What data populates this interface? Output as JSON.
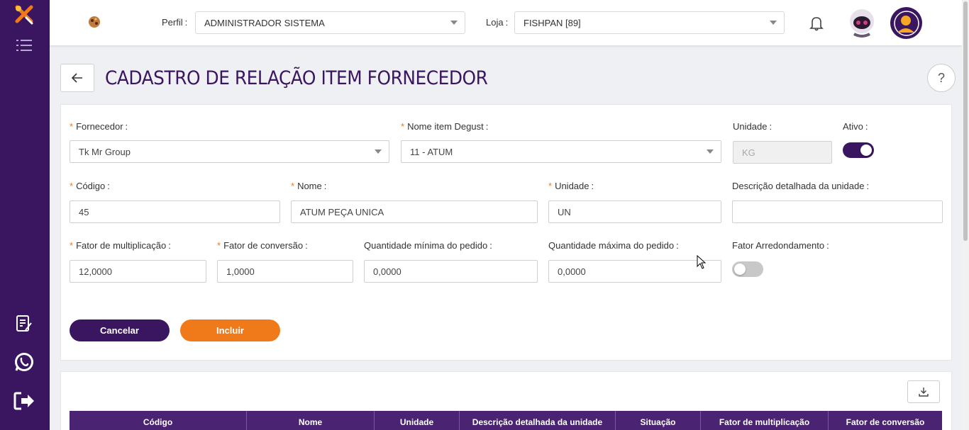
{
  "header": {
    "perfil_label": "Perfil",
    "perfil_value": "ADMINISTRADOR SISTEMA",
    "loja_label": "Loja",
    "loja_value": "FISHPAN [89]"
  },
  "page": {
    "title": "CADASTRO DE RELAÇÃO ITEM FORNECEDOR",
    "help": "?"
  },
  "form": {
    "fornecedor_label": "Fornecedor",
    "fornecedor_value": "Tk Mr Group",
    "nome_item_label": "Nome item Degust",
    "nome_item_value": "11 - ATUM",
    "unidade_top_label": "Unidade",
    "unidade_top_value": "KG",
    "ativo_label": "Ativo",
    "ativo_on": true,
    "codigo_label": "Código",
    "codigo_value": "45",
    "nome_label": "Nome",
    "nome_value": "ATUM PEÇA UNICA",
    "unidade_label": "Unidade",
    "unidade_value": "UN",
    "descricao_label": "Descrição detalhada da unidade",
    "descricao_value": "",
    "fator_mult_label": "Fator de multiplicação",
    "fator_mult_value": "12,0000",
    "fator_conv_label": "Fator de conversão",
    "fator_conv_value": "1,0000",
    "qtd_min_label": "Quantidade mínima do pedido",
    "qtd_min_value": "0,0000",
    "qtd_max_label": "Quantidade máxima do pedido",
    "qtd_max_value": "0,0000",
    "fator_arred_label": "Fator Arredondamento",
    "fator_arred_on": false,
    "cancel_label": "Cancelar",
    "incluir_label": "Incluir"
  },
  "table": {
    "columns": [
      "Código",
      "Nome",
      "Unidade",
      "Descrição detalhada da unidade",
      "Situação",
      "Fator de multiplicação",
      "Fator de conversão"
    ]
  },
  "colors": {
    "brand_purple": "#3a1560",
    "accent_orange": "#f07a1a",
    "table_header": "#4a2373"
  }
}
